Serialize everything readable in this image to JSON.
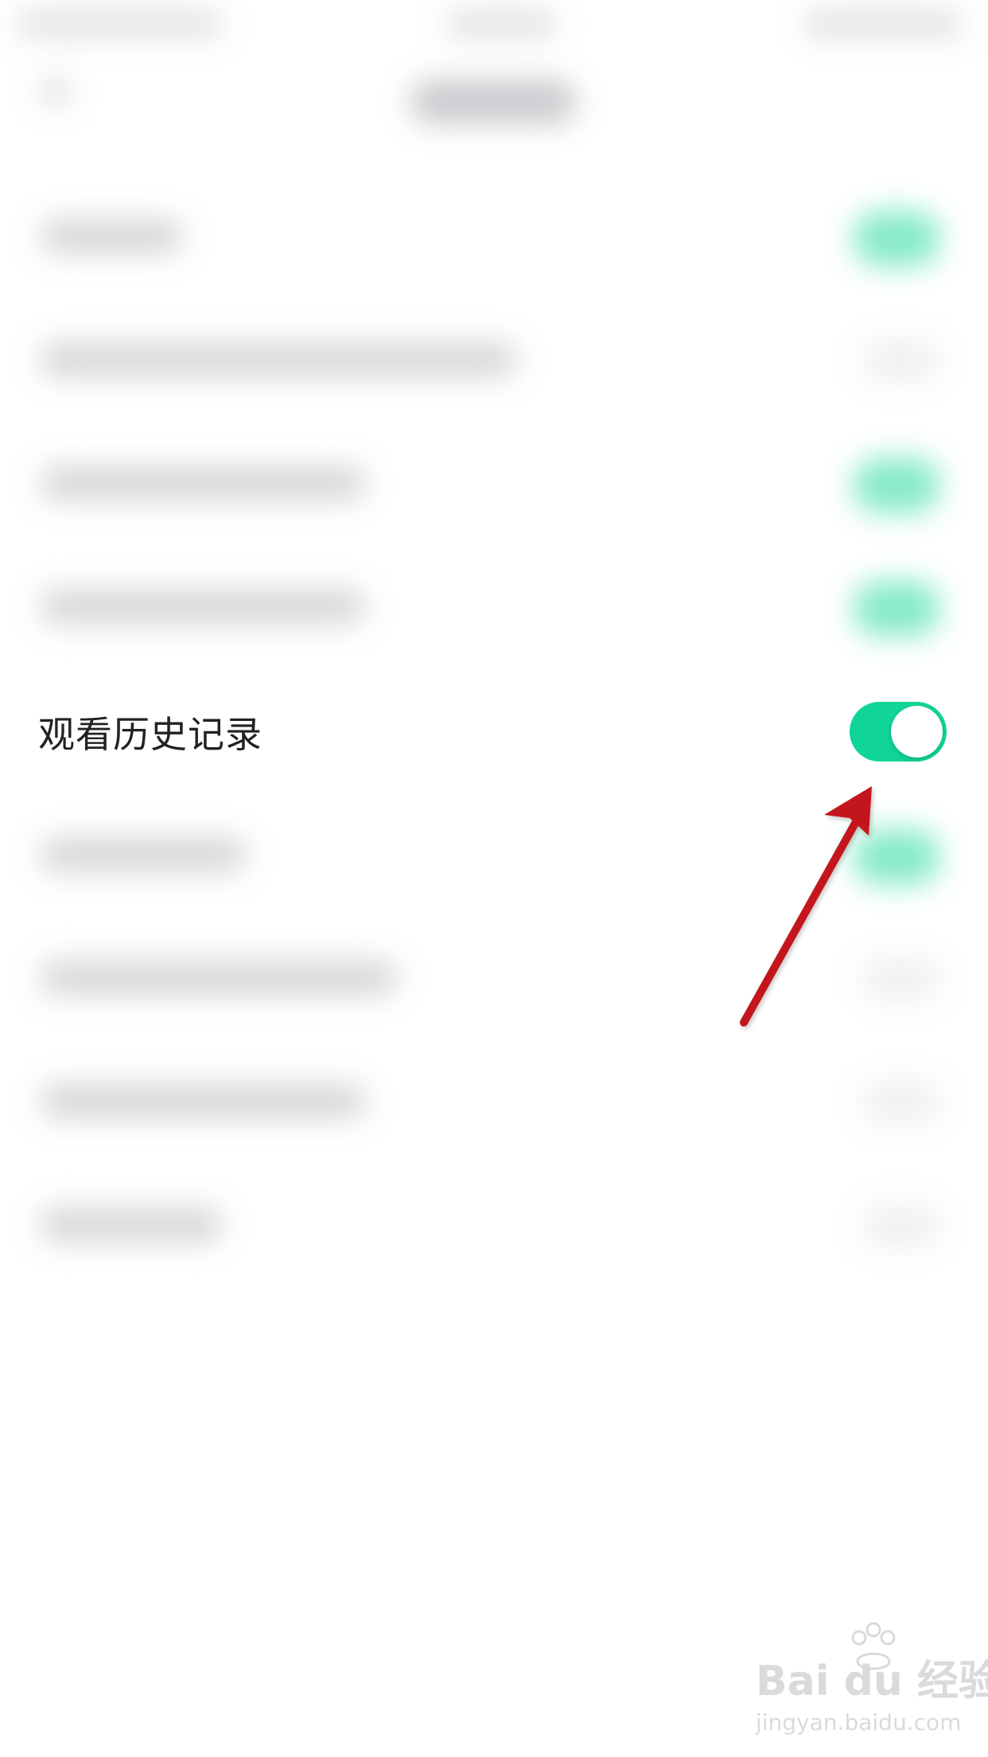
{
  "focused_setting": {
    "label": "观看历史记录",
    "toggle_state": "on"
  },
  "colors": {
    "toggle_on": "#10d498",
    "arrow": "#c3161c",
    "text": "#222222"
  },
  "watermark": {
    "brand": "Bai du 经验",
    "url": "jingyan.baidu.com"
  }
}
